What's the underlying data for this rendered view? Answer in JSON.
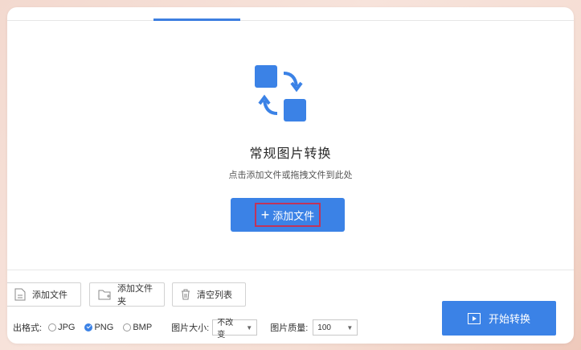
{
  "hero": {
    "title": "常规图片转换",
    "subtitle": "点击添加文件或拖拽文件到此处",
    "add_button_label": "添加文件",
    "add_button_plus": "+"
  },
  "toolbar": {
    "add_file": "添加文件",
    "add_folder": "添加文件夹",
    "clear_list": "清空列表"
  },
  "options": {
    "output_format_label": "出格式:",
    "formats": [
      "JPG",
      "PNG",
      "BMP"
    ],
    "selected_format": "PNG",
    "image_size_label": "图片大小:",
    "image_size_value": "不改变",
    "image_quality_label": "图片质量:",
    "image_quality_value": "100"
  },
  "actions": {
    "start_label": "开始转换"
  },
  "colors": {
    "accent": "#3b82e6",
    "highlight_border": "#c0345a"
  }
}
